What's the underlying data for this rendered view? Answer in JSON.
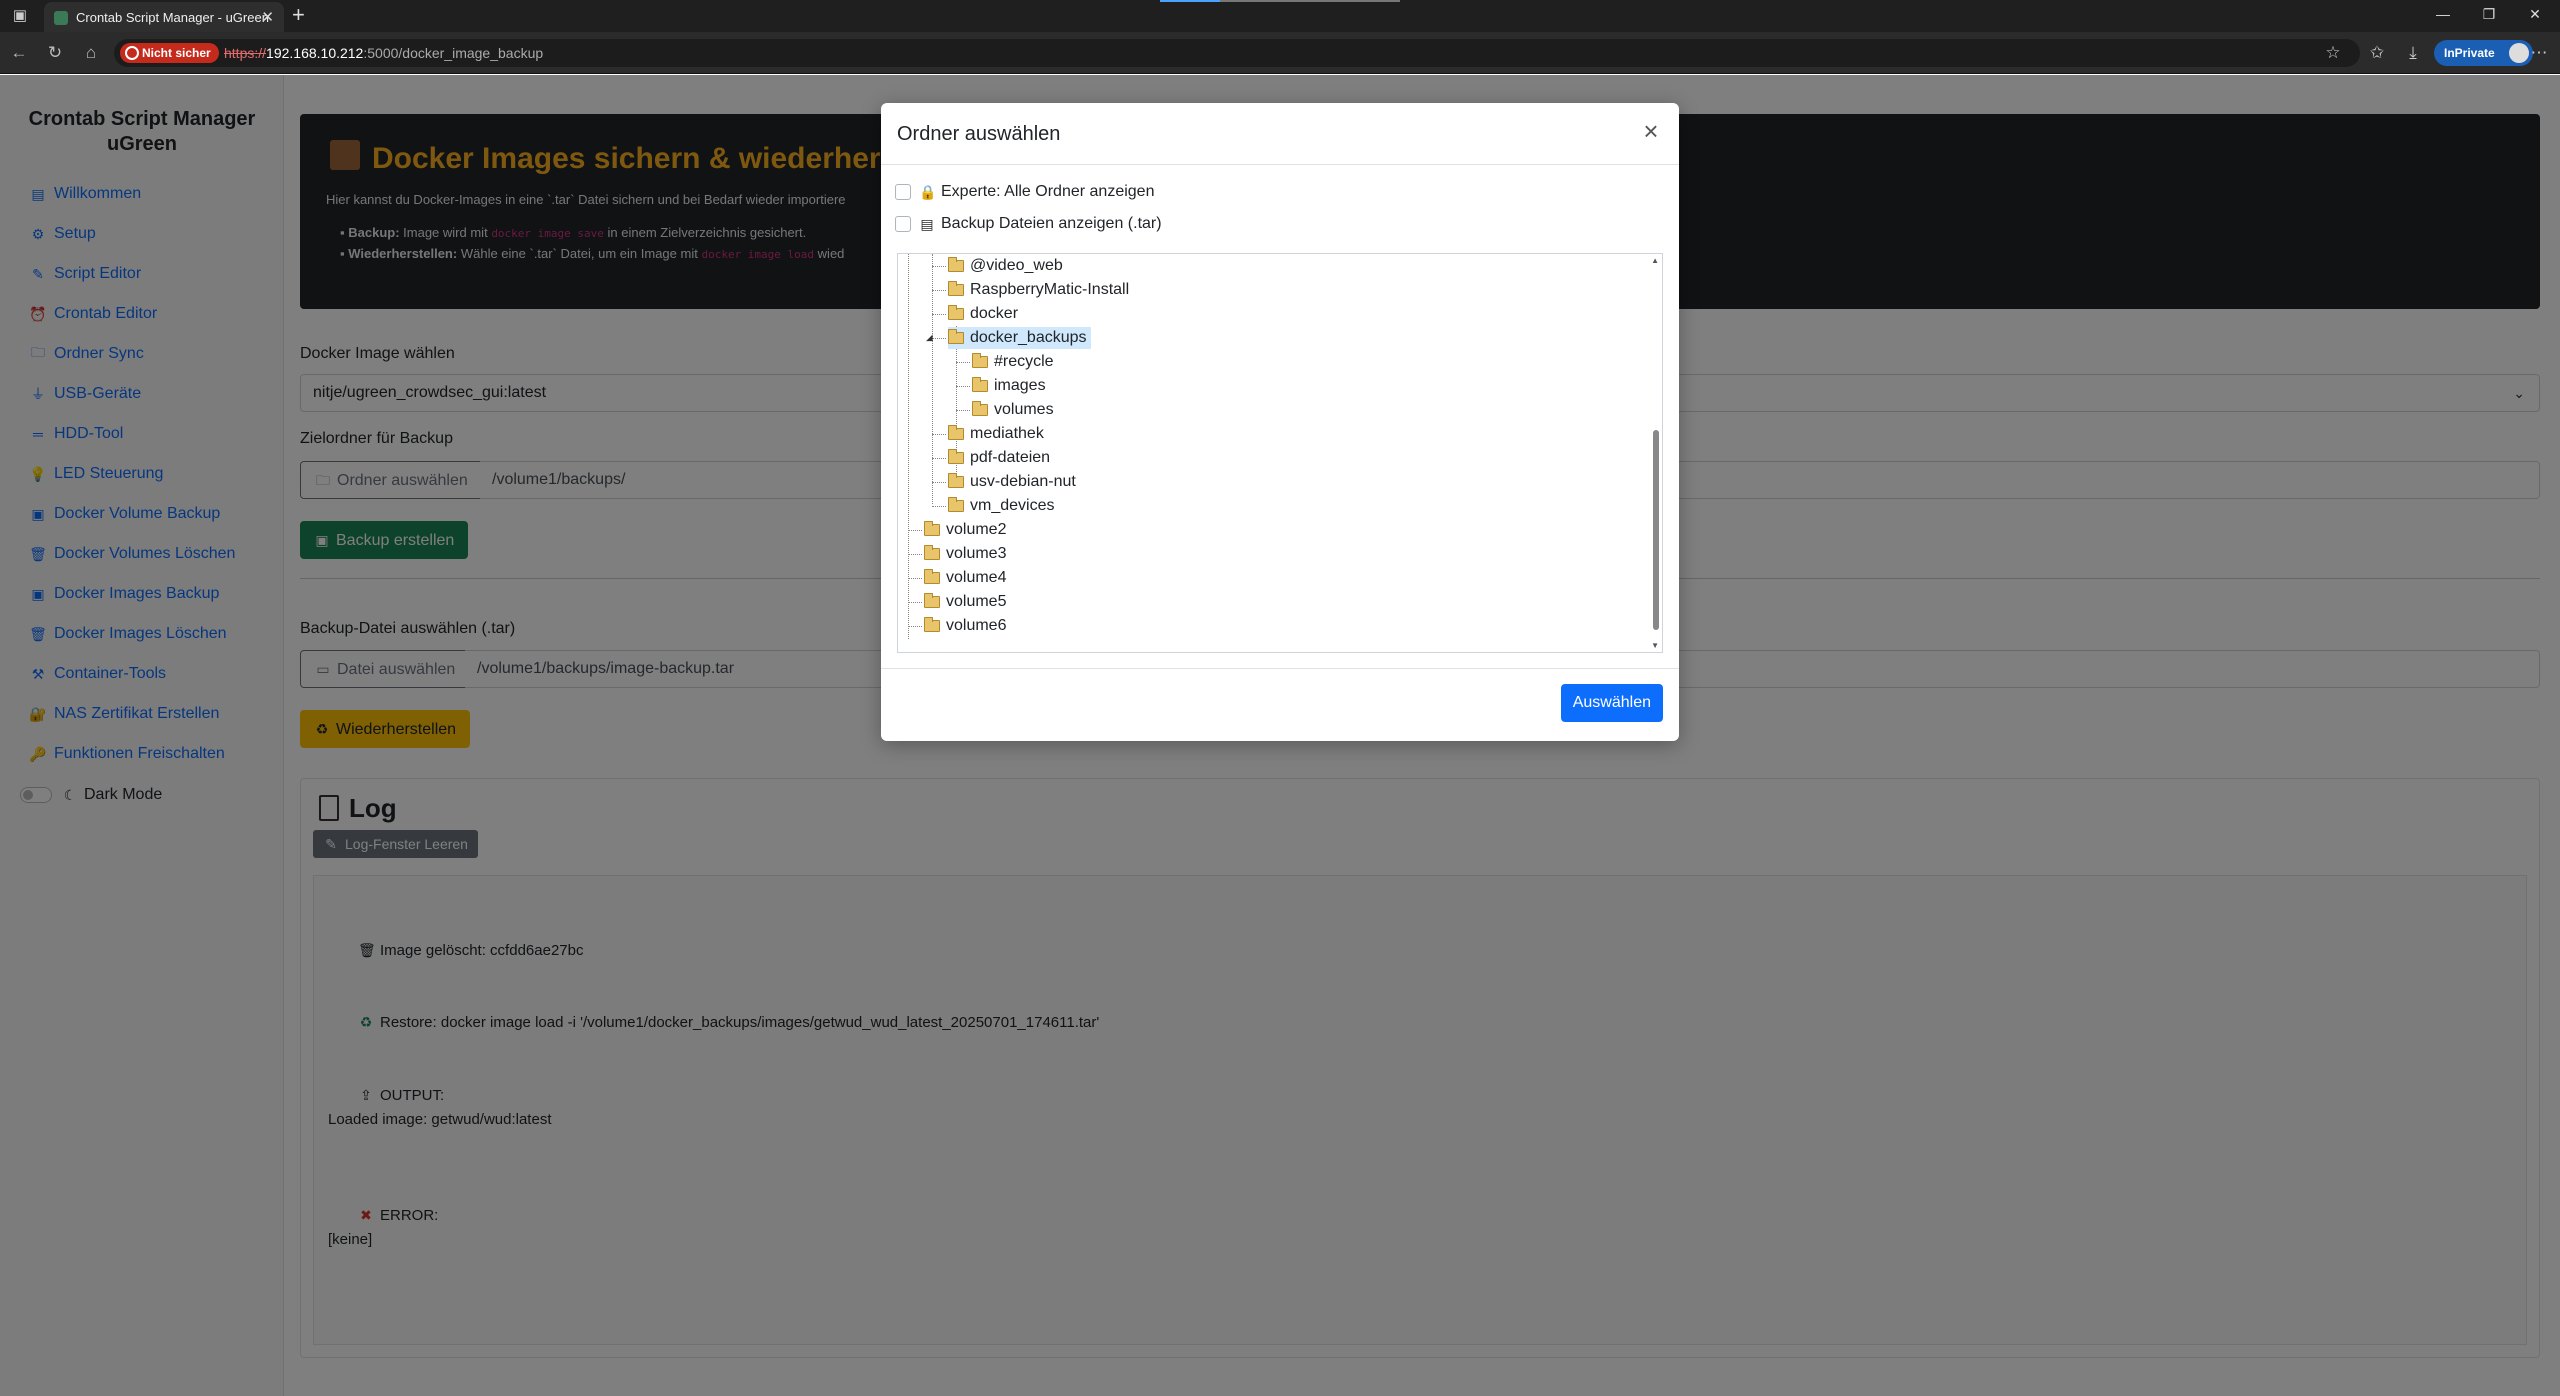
{
  "browser": {
    "tab_title": "Crontab Script Manager - uGreen",
    "not_secure_label": "Nicht sicher",
    "url_scheme": "https://",
    "url_host": "192.168.10.212",
    "url_path": ":5000/docker_image_backup",
    "inprivate_label": "InPrivate"
  },
  "sidebar": {
    "title": "Crontab Script Manager uGreen",
    "items": [
      {
        "label": "Willkommen",
        "icon": "page-icon"
      },
      {
        "label": "Setup",
        "icon": "gear-icon"
      },
      {
        "label": "Script Editor",
        "icon": "memo-icon"
      },
      {
        "label": "Crontab Editor",
        "icon": "alarm-clock-icon"
      },
      {
        "label": "Ordner Sync",
        "icon": "folder-icon"
      },
      {
        "label": "USB-Geräte",
        "icon": "usb-plug-icon"
      },
      {
        "label": "HDD-Tool",
        "icon": "hdd-icon"
      },
      {
        "label": "LED Steuerung",
        "icon": "bulb-icon"
      },
      {
        "label": "Docker Volume Backup",
        "icon": "box-icon"
      },
      {
        "label": "Docker Volumes Löschen",
        "icon": "trash-icon"
      },
      {
        "label": "Docker Images Backup",
        "icon": "box-icon"
      },
      {
        "label": "Docker Images Löschen",
        "icon": "trash-icon"
      },
      {
        "label": "Container-Tools",
        "icon": "tools-icon"
      },
      {
        "label": "NAS Zertifikat Erstellen",
        "icon": "lock-key-icon"
      },
      {
        "label": "Funktionen Freischalten",
        "icon": "key-icon"
      }
    ],
    "dark_mode_label": "Dark Mode"
  },
  "main": {
    "hero": {
      "title": "Docker Images sichern & wiederherstelle",
      "description": "Hier kannst du Docker-Images in eine `.tar` Datei sichern und bei Bedarf wieder importiere",
      "backup_bold": "Backup:",
      "backup_pre": "Image wird mit",
      "backup_code": "docker image save",
      "backup_post": "in einem Zielverzeichnis gesichert.",
      "restore_bold": "Wiederherstellen:",
      "restore_pre": "Wähle eine `.tar` Datei, um ein Image mit",
      "restore_code": "docker image load",
      "restore_post": "wied"
    },
    "image_label": "Docker Image wählen",
    "image_selected": "nitje/ugreen_crowdsec_gui:latest",
    "target_label": "Zielordner für Backup",
    "choose_folder_btn": "Ordner auswählen",
    "target_value": "/volume1/backups/",
    "create_backup_btn": "Backup erstellen",
    "backup_file_label": "Backup-Datei auswählen (.tar)",
    "choose_file_btn": "Datei auswählen",
    "file_value": "/volume1/backups/image-backup.tar",
    "restore_btn": "Wiederherstellen",
    "log": {
      "title": "Log",
      "clear_btn": "Log-Fenster Leeren",
      "lines": [
        "Image gelöscht: ccfdd6ae27bc",
        "Restore: docker image load -i '/volume1/docker_backups/images/getwud_wud_latest_20250701_174611.tar'",
        "OUTPUT:",
        "Loaded image: getwud/wud:latest",
        "ERROR:",
        "[keine]"
      ]
    }
  },
  "modal": {
    "title": "Ordner auswählen",
    "expert_label": "Experte: Alle Ordner anzeigen",
    "show_backup_label": "Backup Dateien anzeigen (.tar)",
    "tree": [
      {
        "label": "@video_web",
        "depth": 2
      },
      {
        "label": "RaspberryMatic-Install",
        "depth": 2
      },
      {
        "label": "docker",
        "depth": 2
      },
      {
        "label": "docker_backups",
        "depth": 2,
        "selected": true,
        "expanded": true
      },
      {
        "label": "#recycle",
        "depth": 3
      },
      {
        "label": "images",
        "depth": 3
      },
      {
        "label": "volumes",
        "depth": 3
      },
      {
        "label": "mediathek",
        "depth": 2
      },
      {
        "label": "pdf-dateien",
        "depth": 2
      },
      {
        "label": "usv-debian-nut",
        "depth": 2
      },
      {
        "label": "vm_devices",
        "depth": 2
      },
      {
        "label": "volume2",
        "depth": 1
      },
      {
        "label": "volume3",
        "depth": 1
      },
      {
        "label": "volume4",
        "depth": 1
      },
      {
        "label": "volume5",
        "depth": 1
      },
      {
        "label": "volume6",
        "depth": 1
      }
    ],
    "select_btn": "Auswählen"
  }
}
